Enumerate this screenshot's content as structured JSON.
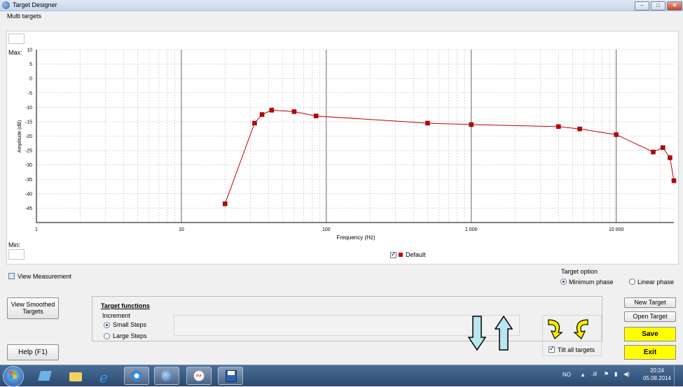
{
  "window": {
    "title": "Target Designer",
    "menu": "Multi targets",
    "min": "–",
    "max": "□",
    "close": "✕"
  },
  "plot": {
    "max_label": "Max:",
    "min_label": "Min:",
    "legend_label": "Default",
    "legend_checked": true,
    "line_color": "#c00000",
    "grid_color": "#bdbdbd"
  },
  "chart_data": {
    "type": "line",
    "xlabel": "Frequency (Hz)",
    "ylabel": "Amplitude (dB)",
    "xscale": "log",
    "xlim": [
      1,
      25000
    ],
    "ylim": [
      -50,
      10
    ],
    "xticks": [
      1,
      10,
      100,
      1000,
      10000
    ],
    "xtick_labels": [
      "1",
      "10",
      "100",
      "1 000",
      "10 000"
    ],
    "yticks": [
      10,
      5,
      0,
      -5,
      -10,
      -15,
      -20,
      -25,
      -30,
      -35,
      -40,
      -45
    ],
    "grid": true,
    "series": [
      {
        "name": "Default",
        "x": [
          20,
          32,
          36,
          42,
          60,
          85,
          500,
          1000,
          4000,
          5600,
          10000,
          18000,
          21000,
          23500,
          25000
        ],
        "y": [
          -43.5,
          -15.5,
          -12.5,
          -11,
          -11.5,
          -13,
          -15.5,
          -16,
          -16.7,
          -17.5,
          -19.5,
          -25.5,
          -24,
          -27.5,
          -35.5
        ]
      }
    ]
  },
  "view_measurement": {
    "label": "View Measurement",
    "checked": false
  },
  "target_option": {
    "title": "Target option",
    "minimum": "Minimum phase",
    "linear": "Linear phase",
    "selected": "minimum"
  },
  "buttons": {
    "view_smoothed": "View Smoothed Targets",
    "help": "Help (F1)",
    "new_target": "New Target",
    "open_target": "Open Target",
    "save": "Save",
    "exit": "Exit"
  },
  "target_functions": {
    "title": "Target functions",
    "increment": "Increment",
    "small": "Small Steps",
    "large": "Large Steps",
    "selected": "small"
  },
  "tilt_all": {
    "label": "Tilt all targets",
    "checked": true
  },
  "taskbar": {
    "lang": "NO",
    "time": "20:24",
    "date": "05.08.2014",
    "icons": [
      "windows-start-icon",
      "app-shortcut-icon",
      "file-explorer-icon",
      "internet-explorer-icon",
      "media-player-icon",
      "target-designer-icon",
      "audio-app-icon",
      "floppy-save-icon"
    ]
  }
}
